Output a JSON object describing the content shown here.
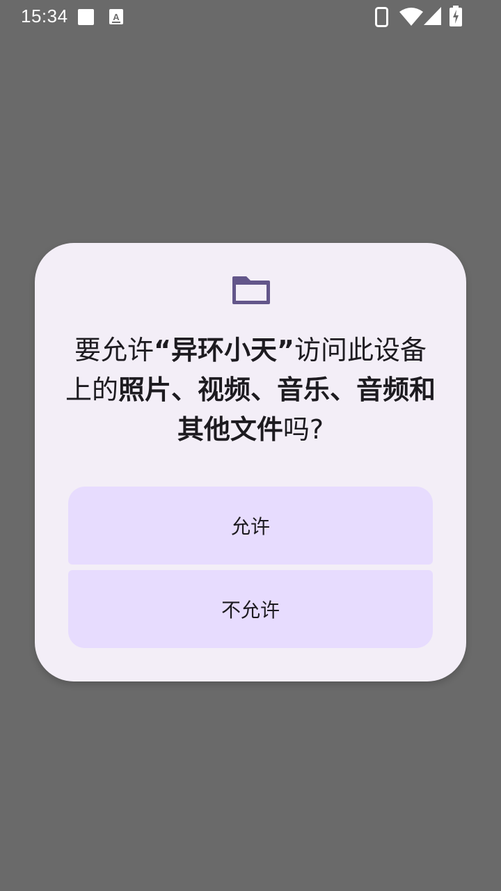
{
  "status_bar": {
    "time": "15:34",
    "icons": [
      "notification-square-icon",
      "a-badge-icon",
      "phone-icon",
      "wifi-icon",
      "signal-icon",
      "battery-charging-icon"
    ]
  },
  "dialog": {
    "icon": "folder-icon",
    "title_parts": {
      "p1": "要允许",
      "p2": "“异环小天”",
      "p3": "访问此设备上的",
      "p4": "照片、视频、音乐、音频和其他文件",
      "p5": "吗?"
    },
    "allow_label": "允许",
    "deny_label": "不允许"
  },
  "colors": {
    "scrim": "#6a6a6a",
    "dialog_bg": "#f3eef7",
    "button_bg": "#e7dcfe",
    "icon_accent": "#63568a",
    "text": "#1d1b20"
  }
}
